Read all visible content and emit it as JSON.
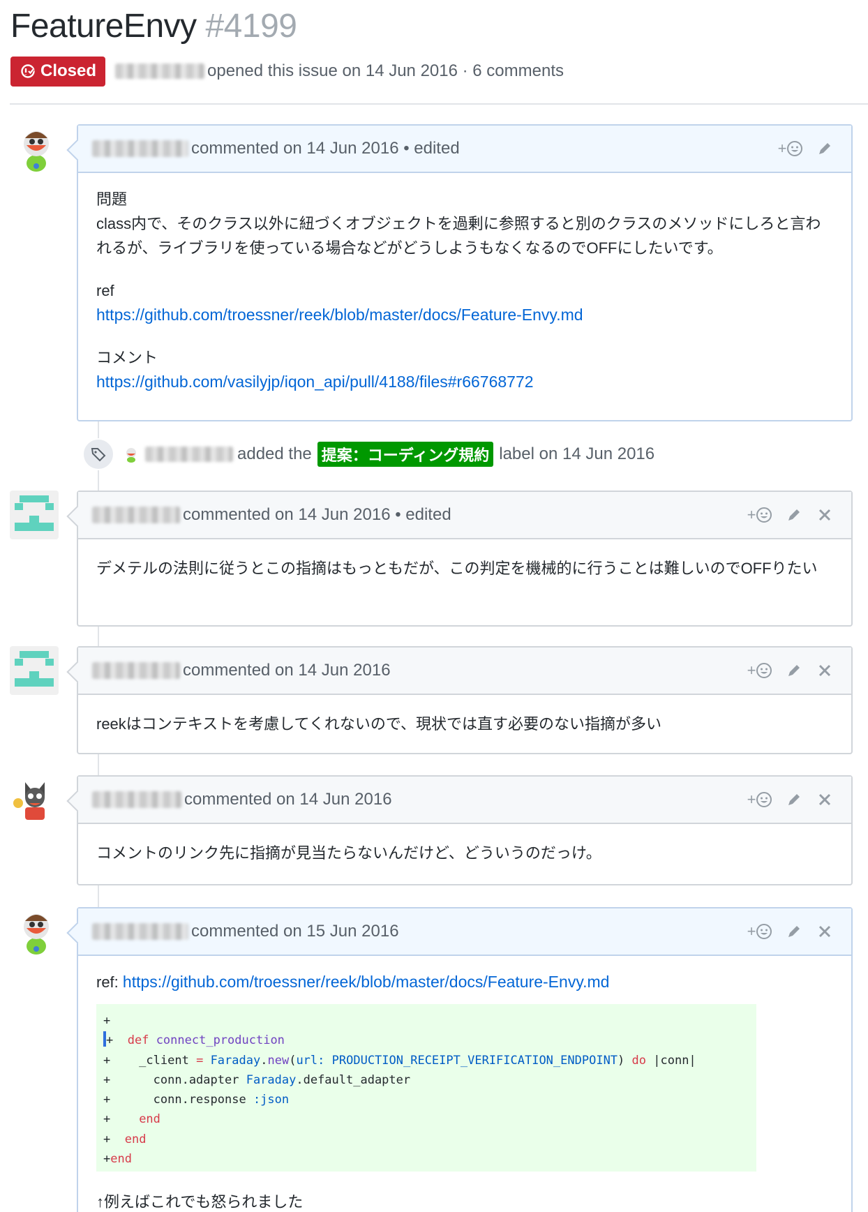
{
  "issue": {
    "title": "FeatureEnvy",
    "number": "#4199",
    "status": "Closed",
    "opened_text": "opened this issue on 14 Jun 2016 · 6 comments"
  },
  "comments": [
    {
      "meta": "commented on 14 Jun 2016 • edited",
      "body": [
        "問題",
        "class内で、そのクラス以外に紐づくオブジェクトを過剰に参照すると別のクラスのメソッドにしろと言われるが、ライブラリを使っている場合などがどうしようもなくなるのでOFFにしたいです。",
        "ref",
        "https://github.com/troessner/reek/blob/master/docs/Feature-Envy.md",
        "コメント",
        "https://github.com/vasilyjp/iqon_api/pull/4188/files#r66768772"
      ]
    },
    {
      "meta": "commented on 14 Jun 2016 • edited",
      "body": [
        "デメテルの法則に従うとこの指摘はもっともだが、この判定を機械的に行うことは難しいのでOFFりたい"
      ]
    },
    {
      "meta": "commented on 14 Jun 2016",
      "body": [
        "reekはコンテキストを考慮してくれないので、現状では直す必要のない指摘が多い"
      ]
    },
    {
      "meta": "commented on 14 Jun 2016",
      "body": [
        "コメントのリンク先に指摘が見当たらないんだけど、どういうのだっけ。"
      ]
    },
    {
      "meta": "commented on 15 Jun 2016",
      "ref_label": "ref: ",
      "ref_link": "https://github.com/troessner/reek/blob/master/docs/Feature-Envy.md",
      "after_text": "↑例えばこれでも怒られました"
    }
  ],
  "event": {
    "prefix": "added the",
    "label": "提案：コーディング規約",
    "suffix": "label on 14 Jun 2016",
    "label_color": "#009800"
  },
  "code": [
    "+",
    "+  def connect_production",
    "+    _client = Faraday.new(url: PRODUCTION_RECEIPT_VERIFICATION_ENDPOINT) do |conn|",
    "+      conn.adapter Faraday.default_adapter",
    "+      conn.response :json",
    "+    end",
    "+  end",
    "+end"
  ],
  "icons": {
    "reaction": "smiley-icon",
    "edit": "pencil-icon",
    "delete": "x-icon",
    "label": "tag-icon",
    "status": "issue-closed-icon"
  },
  "colors": {
    "closed": "#cb2431",
    "link": "#0366d6",
    "added_code_bg": "#eaffea"
  }
}
